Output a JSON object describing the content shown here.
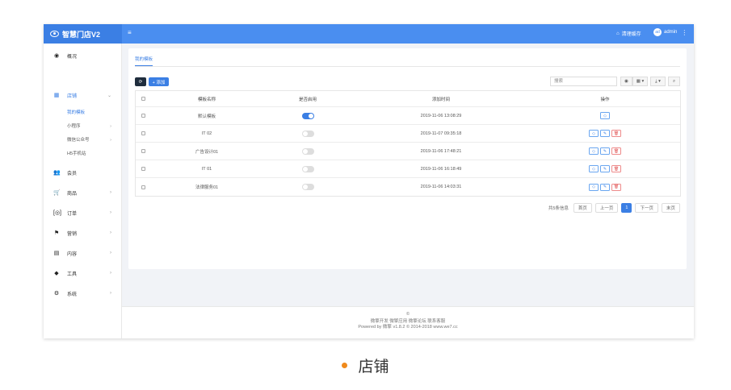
{
  "colors": {
    "accent": "#3b7fe4",
    "topbar": "#4a8ef0",
    "dark_button": "#1f2d3d",
    "caption_dot": "#f08a1c"
  },
  "app": {
    "title": "智慧门店V2",
    "logo_icon": "eye-logo-icon",
    "menu_icon": "hamburger-icon"
  },
  "header": {
    "cache_label": "清理缓存",
    "cache_icon": "broom-icon",
    "avatar_text": "ad",
    "username": "admin",
    "more_icon": "vertical-dots-icon"
  },
  "sidebar": {
    "items": [
      {
        "label": "概况",
        "icon": "dashboard-icon",
        "glyph": "◉",
        "arrow": ""
      },
      {
        "label": "店铺",
        "icon": "grid-icon",
        "glyph": "▦",
        "arrow": "⌄"
      },
      {
        "label": "会员",
        "icon": "users-icon",
        "glyph": "👥",
        "arrow": ""
      },
      {
        "label": "商品",
        "icon": "cart-icon",
        "glyph": "🛒",
        "arrow": "›"
      },
      {
        "label": "订单",
        "icon": "order-icon",
        "glyph": "[◎]",
        "arrow": "›"
      },
      {
        "label": "营销",
        "icon": "flag-icon",
        "glyph": "⚑",
        "arrow": "›"
      },
      {
        "label": "内容",
        "icon": "document-icon",
        "glyph": "▤",
        "arrow": "›"
      },
      {
        "label": "工具",
        "icon": "cube-icon",
        "glyph": "◆",
        "arrow": "›"
      },
      {
        "label": "系统",
        "icon": "gear-icon",
        "glyph": "⚙",
        "arrow": "›"
      }
    ],
    "subitems": [
      {
        "label": "我的模板",
        "arrow": ""
      },
      {
        "label": "小程序",
        "arrow": "›"
      },
      {
        "label": "微信公众号",
        "arrow": "›"
      },
      {
        "label": "H5手机站",
        "arrow": ""
      }
    ]
  },
  "main": {
    "tab": "我的模板",
    "refresh_icon": "refresh-icon",
    "add_label": "+ 添加",
    "search_placeholder": "搜索",
    "tools": [
      {
        "icon": "eye-icon",
        "label": "◉"
      },
      {
        "icon": "columns-icon",
        "label": "▦ ▾"
      },
      {
        "icon": "download-icon",
        "label": "⤓ ▾"
      },
      {
        "icon": "search-icon",
        "label": "⌕"
      }
    ]
  },
  "table": {
    "columns": [
      "模板名称",
      "是否启用",
      "添加时间",
      "操作"
    ],
    "rows": [
      {
        "name": "默认模板",
        "enabled": true,
        "time": "2019-11-06 13:08:29",
        "actions": [
          "preview"
        ]
      },
      {
        "name": "IT 02",
        "enabled": false,
        "time": "2019-11-07 09:35:18",
        "actions": [
          "preview",
          "edit",
          "delete"
        ]
      },
      {
        "name": "广告设计01",
        "enabled": false,
        "time": "2019-11-06 17:48:21",
        "actions": [
          "preview",
          "edit",
          "delete"
        ]
      },
      {
        "name": "IT 01",
        "enabled": false,
        "time": "2019-11-06 16:18:49",
        "actions": [
          "preview",
          "edit",
          "delete"
        ]
      },
      {
        "name": "法律服务01",
        "enabled": false,
        "time": "2019-11-06 14:03:31",
        "actions": [
          "preview",
          "edit",
          "delete"
        ]
      }
    ]
  },
  "pagination": {
    "total": "共5条信息",
    "first": "首页",
    "prev": "上一页",
    "current": "1",
    "next": "下一页",
    "last": "末页"
  },
  "footer": {
    "symbol": "©",
    "links": "微擎开发 微擎应用 微擎论坛 联系客服",
    "powered": "Powered by 微擎 v1.8.2 © 2014-2018 www.we7.cc"
  },
  "caption": "店铺"
}
